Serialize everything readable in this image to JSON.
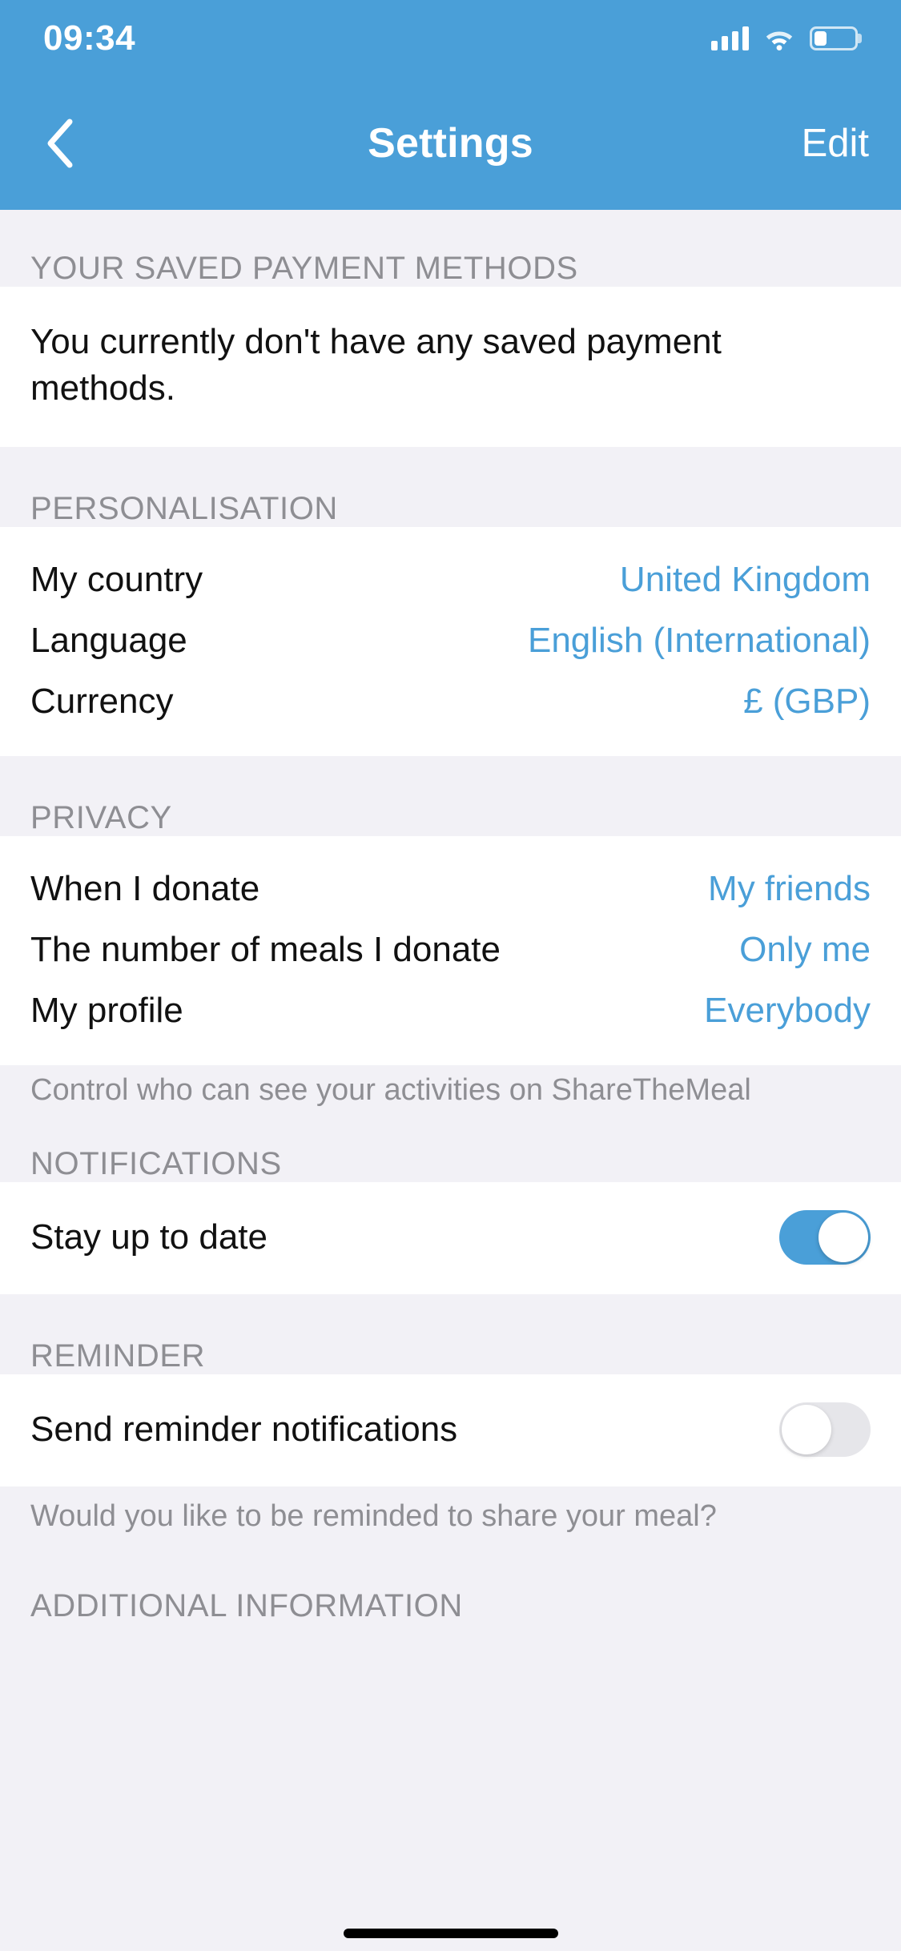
{
  "statusbar": {
    "time": "09:34",
    "signal_icon": "cellular-signal-icon",
    "wifi_icon": "wifi-icon",
    "battery_icon": "battery-icon",
    "battery_level_percent": 32
  },
  "navbar": {
    "back_icon": "chevron-left-icon",
    "title": "Settings",
    "edit_label": "Edit"
  },
  "colors": {
    "header_blue": "#4a9fd8",
    "accent_blue": "#4a9fd8",
    "section_gray_bg": "#f2f1f6",
    "section_header_text": "#8e8e93",
    "label_text": "#111111",
    "toggle_off_track": "#e6e6ea"
  },
  "sections": {
    "payment_methods": {
      "header": "YOUR SAVED PAYMENT METHODS",
      "body": "You currently don't have any saved payment methods."
    },
    "personalisation": {
      "header": "PERSONALISATION",
      "rows": [
        {
          "label": "My country",
          "value": "United Kingdom"
        },
        {
          "label": "Language",
          "value": "English (International)"
        },
        {
          "label": "Currency",
          "value": "£ (GBP)"
        }
      ]
    },
    "privacy": {
      "header": "PRIVACY",
      "rows": [
        {
          "label": "When I donate",
          "value": "My friends"
        },
        {
          "label": "The number of meals I donate",
          "value": "Only me"
        },
        {
          "label": "My profile",
          "value": "Everybody"
        }
      ],
      "note": "Control who can see your activities on ShareTheMeal"
    },
    "notifications": {
      "header": "NOTIFICATIONS",
      "rows": [
        {
          "label": "Stay up to date",
          "toggle": "on"
        }
      ]
    },
    "reminder": {
      "header": "REMINDER",
      "rows": [
        {
          "label": "Send reminder notifications",
          "toggle": "off"
        }
      ],
      "note": "Would you like to be reminded to share your meal?"
    },
    "additional_information": {
      "header": "ADDITIONAL INFORMATION"
    }
  }
}
